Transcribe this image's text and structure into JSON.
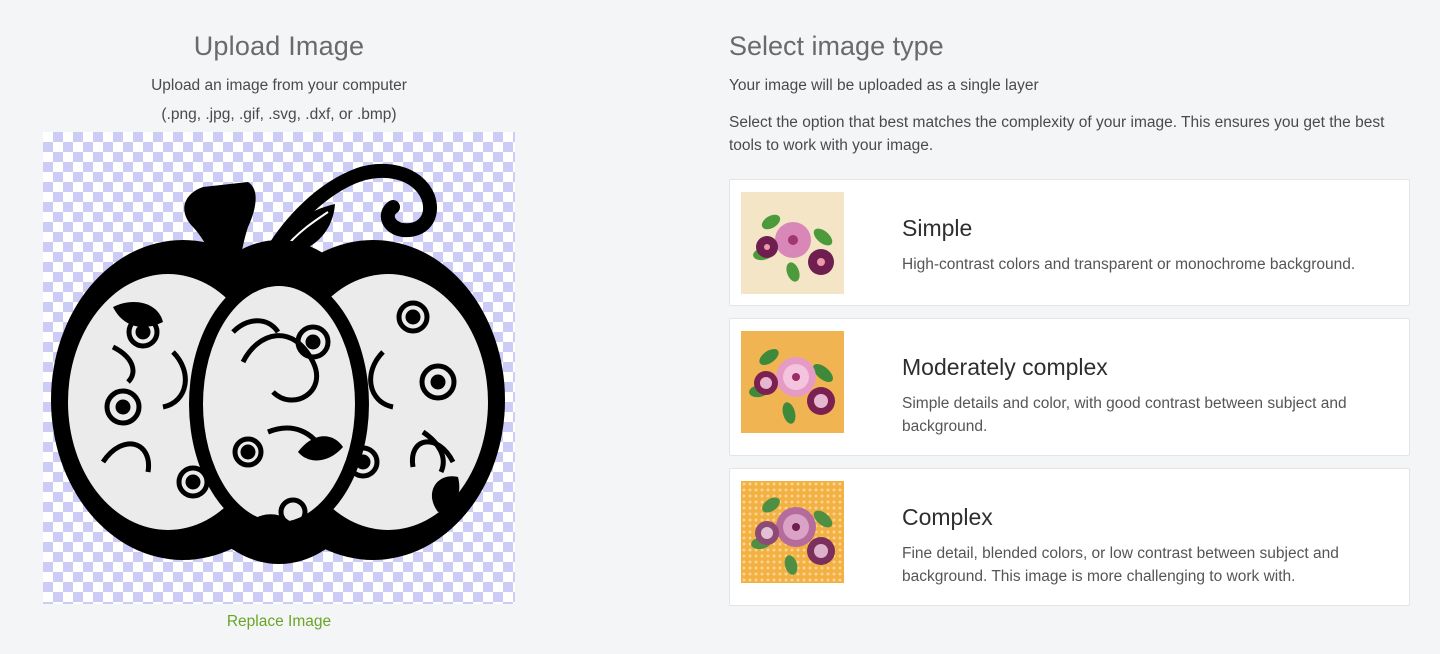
{
  "upload": {
    "title": "Upload Image",
    "subtitle": "Upload an image from your computer",
    "formats": "(.png, .jpg, .gif, .svg, .dxf, or .bmp)",
    "replace_label": "Replace Image"
  },
  "image_type": {
    "title": "Select image type",
    "subtitle": "Your image will be uploaded as a single layer",
    "description": "Select the option that best matches the complexity of your image. This ensures you get the best tools to work with your image.",
    "options": [
      {
        "title": "Simple",
        "text": "High-contrast colors and transparent or monochrome background."
      },
      {
        "title": "Moderately complex",
        "text": "Simple details and color, with good contrast between subject and background."
      },
      {
        "title": "Complex",
        "text": "Fine detail, blended colors, or low contrast between subject and background. This image is more challenging to work with."
      }
    ]
  },
  "colors": {
    "link_green": "#6aa526",
    "checker_lavender": "#ccccf6",
    "simple_bg": "#f3e5c6",
    "moderate_bg": "#f0b552",
    "complex_bg": "#f3b144"
  }
}
